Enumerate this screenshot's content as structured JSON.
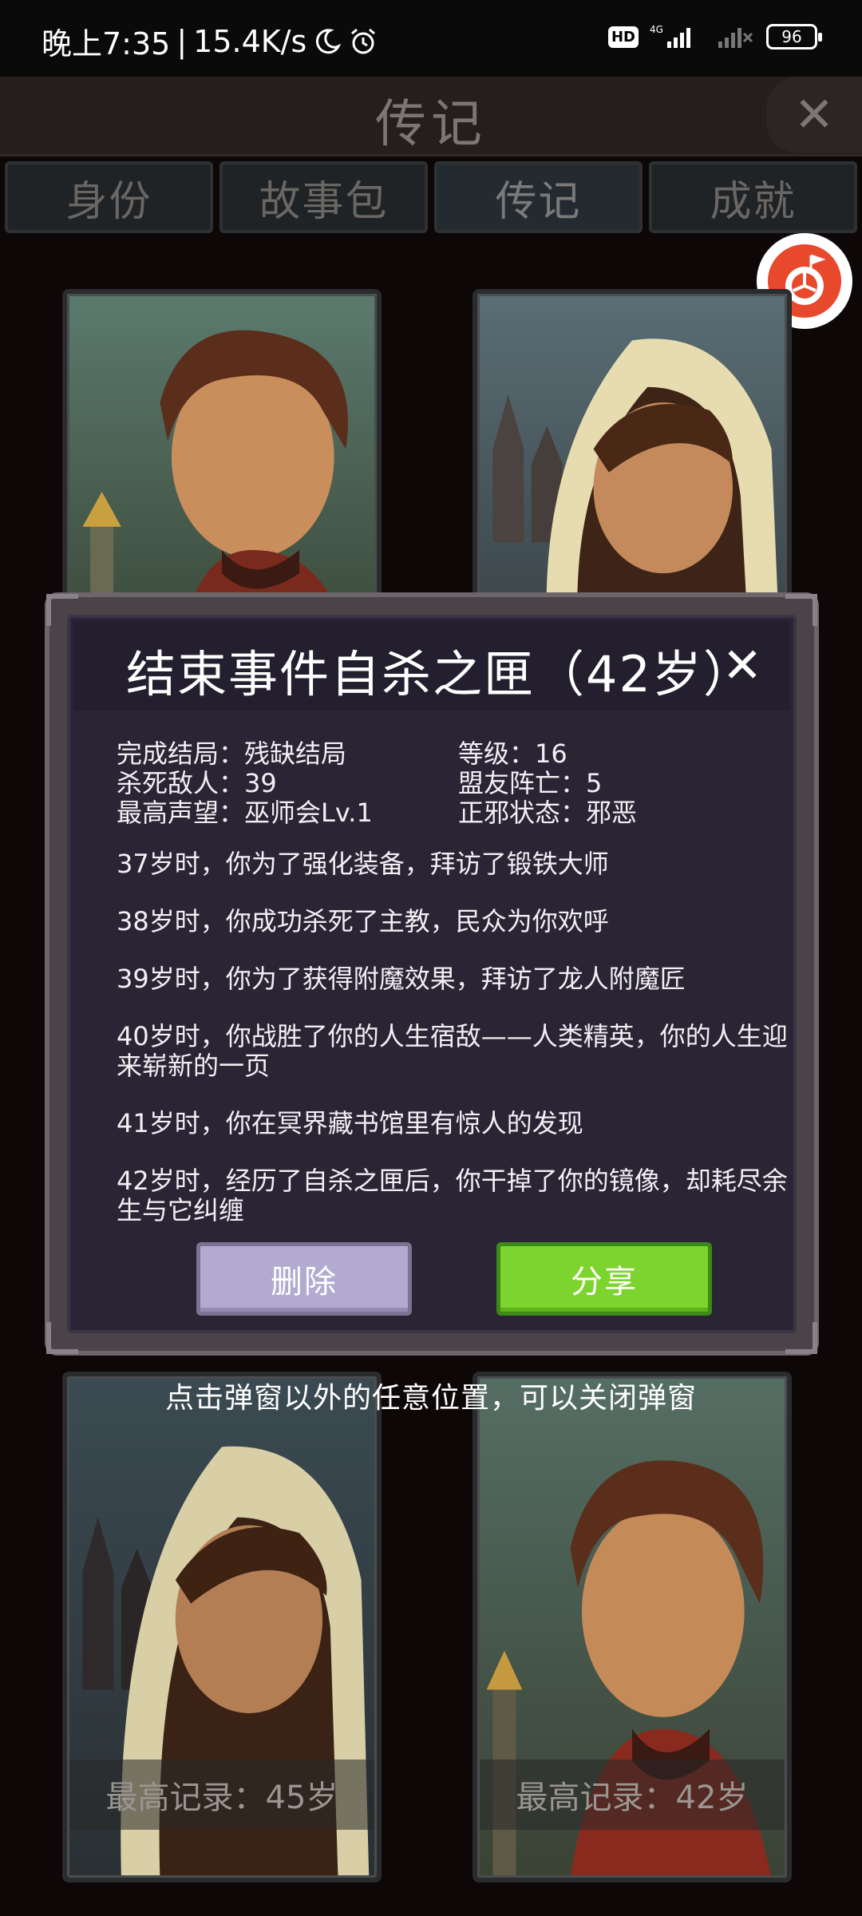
{
  "status_bar": {
    "time": "晚上7:35",
    "speed": "15.4K/s",
    "hd": "HD",
    "network": "4G",
    "battery": "96"
  },
  "header": {
    "title": "传记"
  },
  "tabs": [
    {
      "label": "身份"
    },
    {
      "label": "故事包"
    },
    {
      "label": "传记"
    },
    {
      "label": "成就"
    }
  ],
  "cards": [
    {
      "record": ""
    },
    {
      "record": ""
    },
    {
      "record": "最高记录：45岁"
    },
    {
      "record": "最高记录：42岁"
    }
  ],
  "modal": {
    "title": "结束事件自杀之匣（42岁）",
    "stats": [
      "完成结局：残缺结局",
      "等级：16",
      "杀死敌人：39",
      "盟友阵亡：5",
      "最高声望：巫师会Lv.1",
      "正邪状态：邪恶"
    ],
    "events": [
      "37岁时，你为了强化装备，拜访了锻铁大师",
      "38岁时，你成功杀死了主教，民众为你欢呼",
      "39岁时，你为了获得附魔效果，拜访了龙人附魔匠",
      "40岁时，你战胜了你的人生宿敌——人类精英，你的人生迎来崭新的一页",
      "41岁时，你在冥界藏书馆里有惊人的发现",
      "42岁时，经历了自杀之匣后，你干掉了你的镜像，却耗尽余生与它纠缠"
    ],
    "delete_label": "删除",
    "share_label": "分享"
  },
  "hint": "点击弹窗以外的任意位置，可以关闭弹窗"
}
